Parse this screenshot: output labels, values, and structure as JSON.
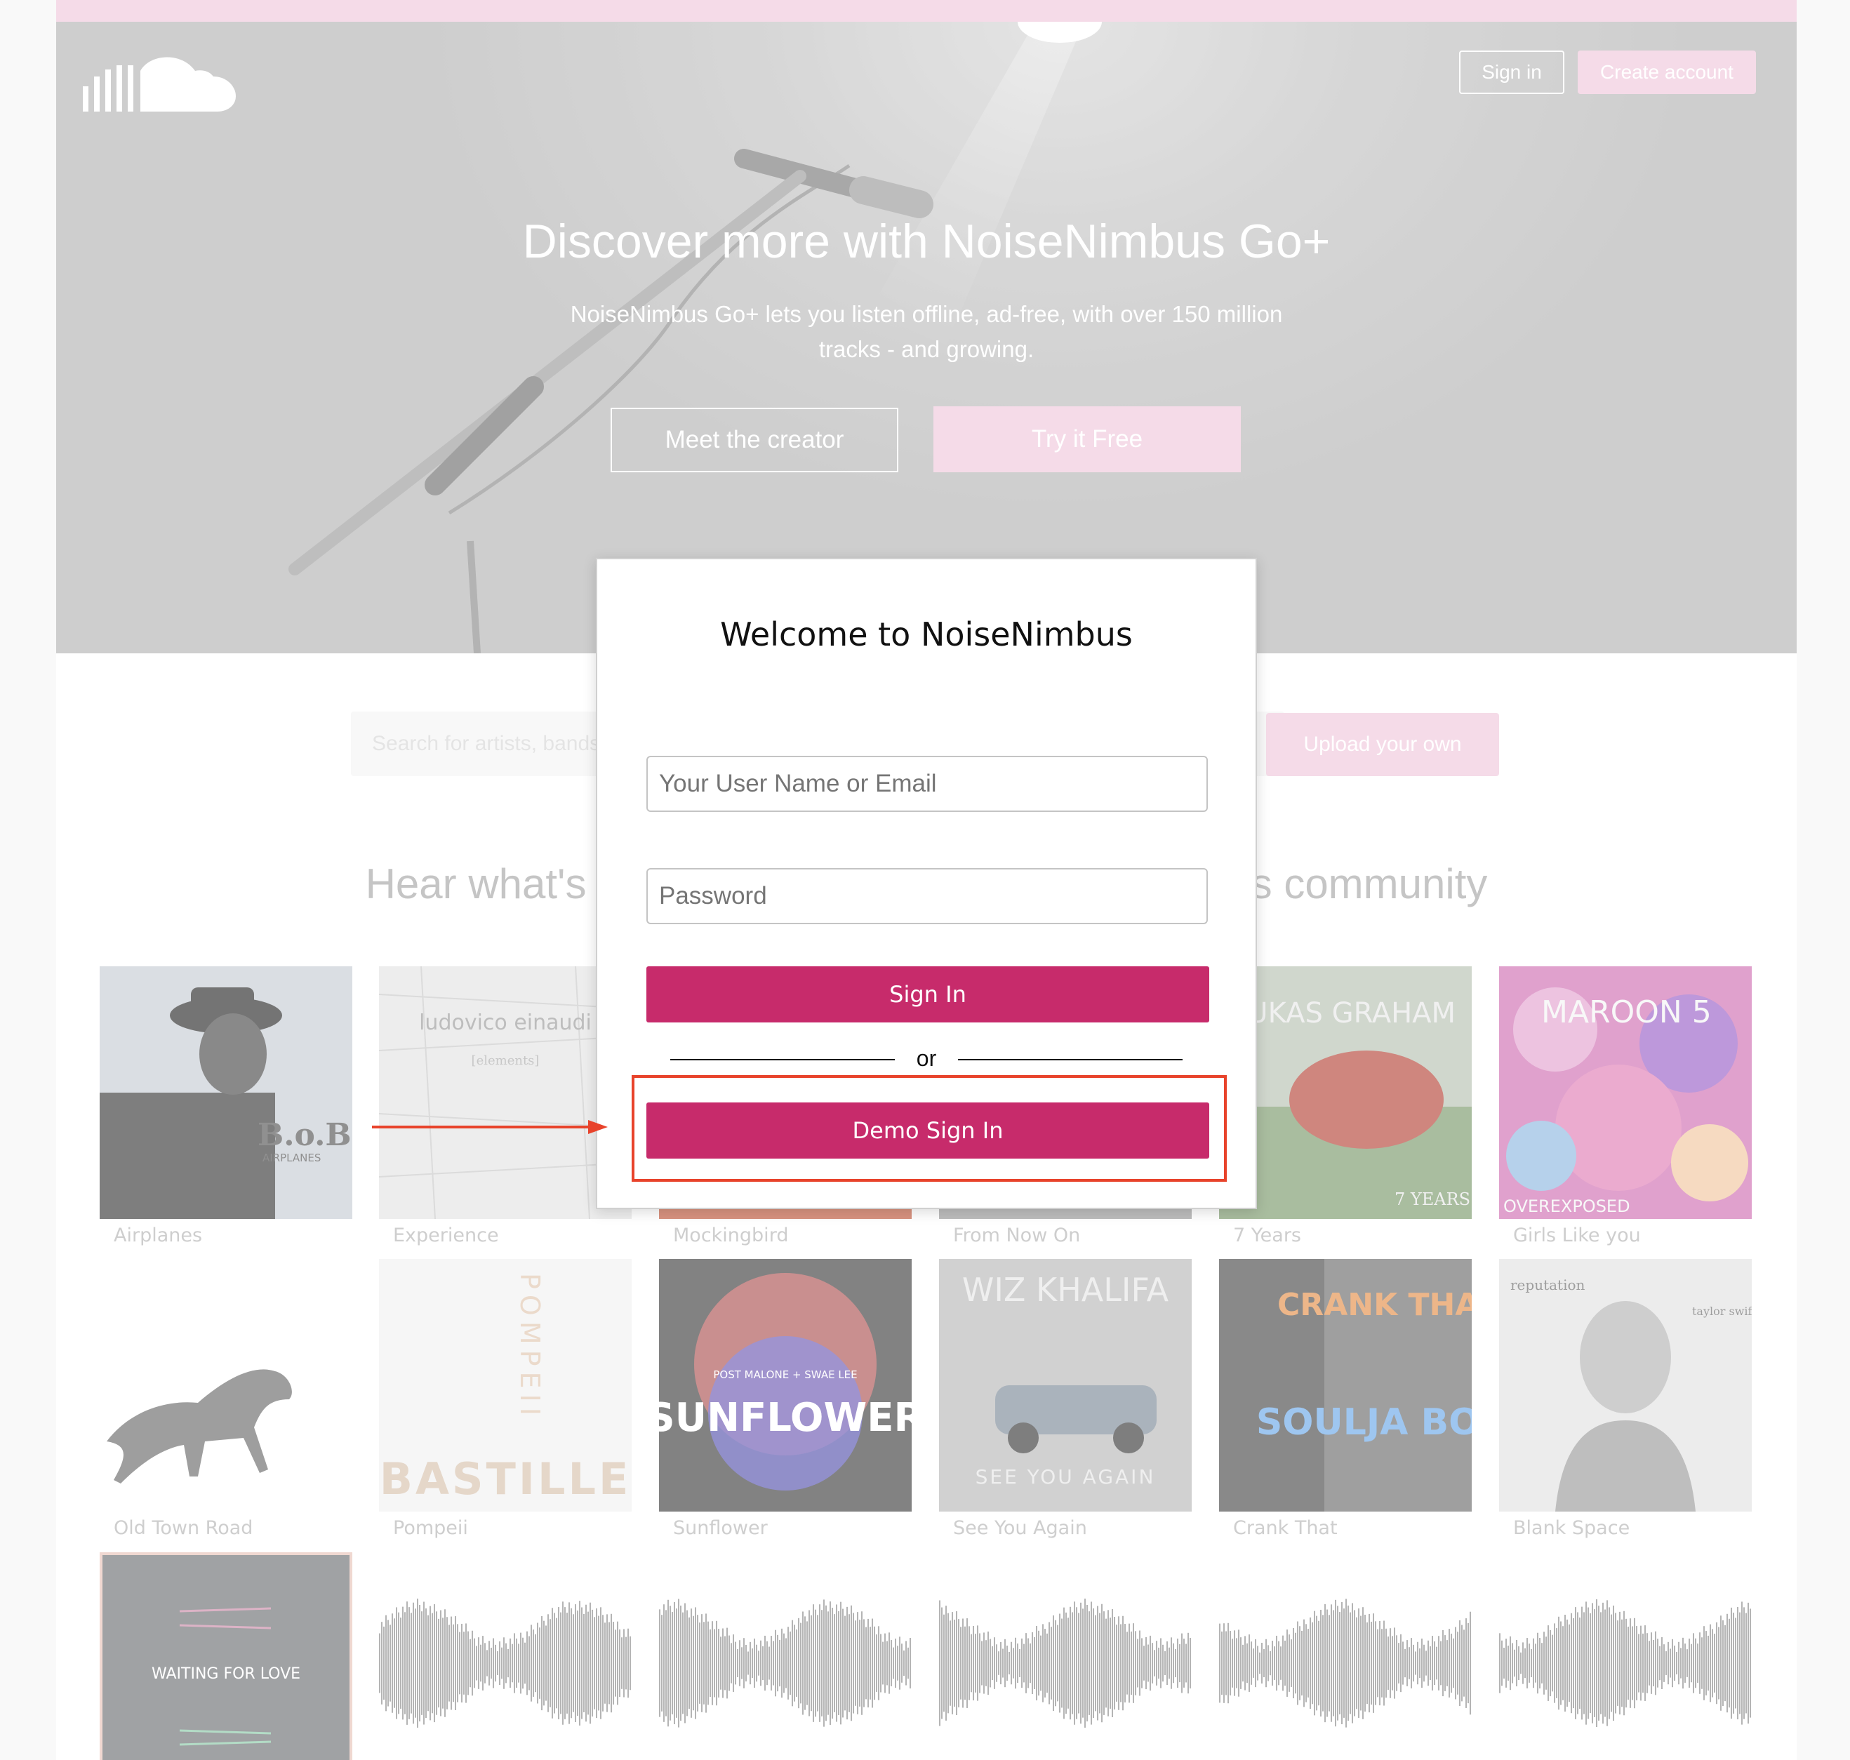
{
  "header": {
    "sign_in_label": "Sign in",
    "create_account_label": "Create account"
  },
  "hero": {
    "title": "Discover more with NoiseNimbus Go+",
    "subtitle_line1": "NoiseNimbus Go+ lets you listen offline, ad-free, with over 150 million",
    "subtitle_line2": "tracks - and growing.",
    "meet_button": "Meet the creator",
    "try_button": "Try it Free"
  },
  "search": {
    "placeholder": "Search for artists, bands, tracks, podcasts",
    "upload_button": "Upload your own"
  },
  "section": {
    "title": "Hear what's trending for free in the NoiseNimbus community"
  },
  "tracks": [
    {
      "title": "Airplanes",
      "cover_text": "B.o.B",
      "cover_sub": "AIRPLANES"
    },
    {
      "title": "Experience",
      "cover_text": "ludovico einaudi",
      "cover_sub": "[elements]"
    },
    {
      "title": "Mockingbird"
    },
    {
      "title": "From Now On"
    },
    {
      "title": "7 Years",
      "cover_text": "LUKAS GRAHAM",
      "cover_sub": "7 YEARS"
    },
    {
      "title": "Girls Like you",
      "cover_text": "MAROON 5",
      "cover_sub": "OVEREXPOSED"
    },
    {
      "title": "Old Town Road"
    },
    {
      "title": "Pompeii",
      "cover_text": "BASTILLE",
      "cover_sub": "POMPEII"
    },
    {
      "title": "Sunflower",
      "cover_text": "SUNFLOWER",
      "cover_sub": "POST MALONE + SWAE LEE"
    },
    {
      "title": "See You Again",
      "cover_text": "WIZ KHALIFA",
      "cover_sub": "SEE YOU AGAIN"
    },
    {
      "title": "Crank That",
      "cover_text": "CRANK THAT",
      "cover_sub": "SOULJA BOY"
    },
    {
      "title": "Blank Space",
      "cover_text": "reputation",
      "cover_sub": "taylor swift"
    },
    {
      "title": "",
      "cover_text": "WAITING FOR LOVE"
    }
  ],
  "modal": {
    "title": "Welcome to NoiseNimbus",
    "username_placeholder": "Your User Name or Email",
    "password_placeholder": "Password",
    "sign_in_button": "Sign In",
    "or_text": "or",
    "demo_button": "Demo Sign In"
  },
  "colors": {
    "brand_pink": "#c72b6b",
    "light_pink": "#f0c8dc",
    "highlight": "#e8432b"
  }
}
